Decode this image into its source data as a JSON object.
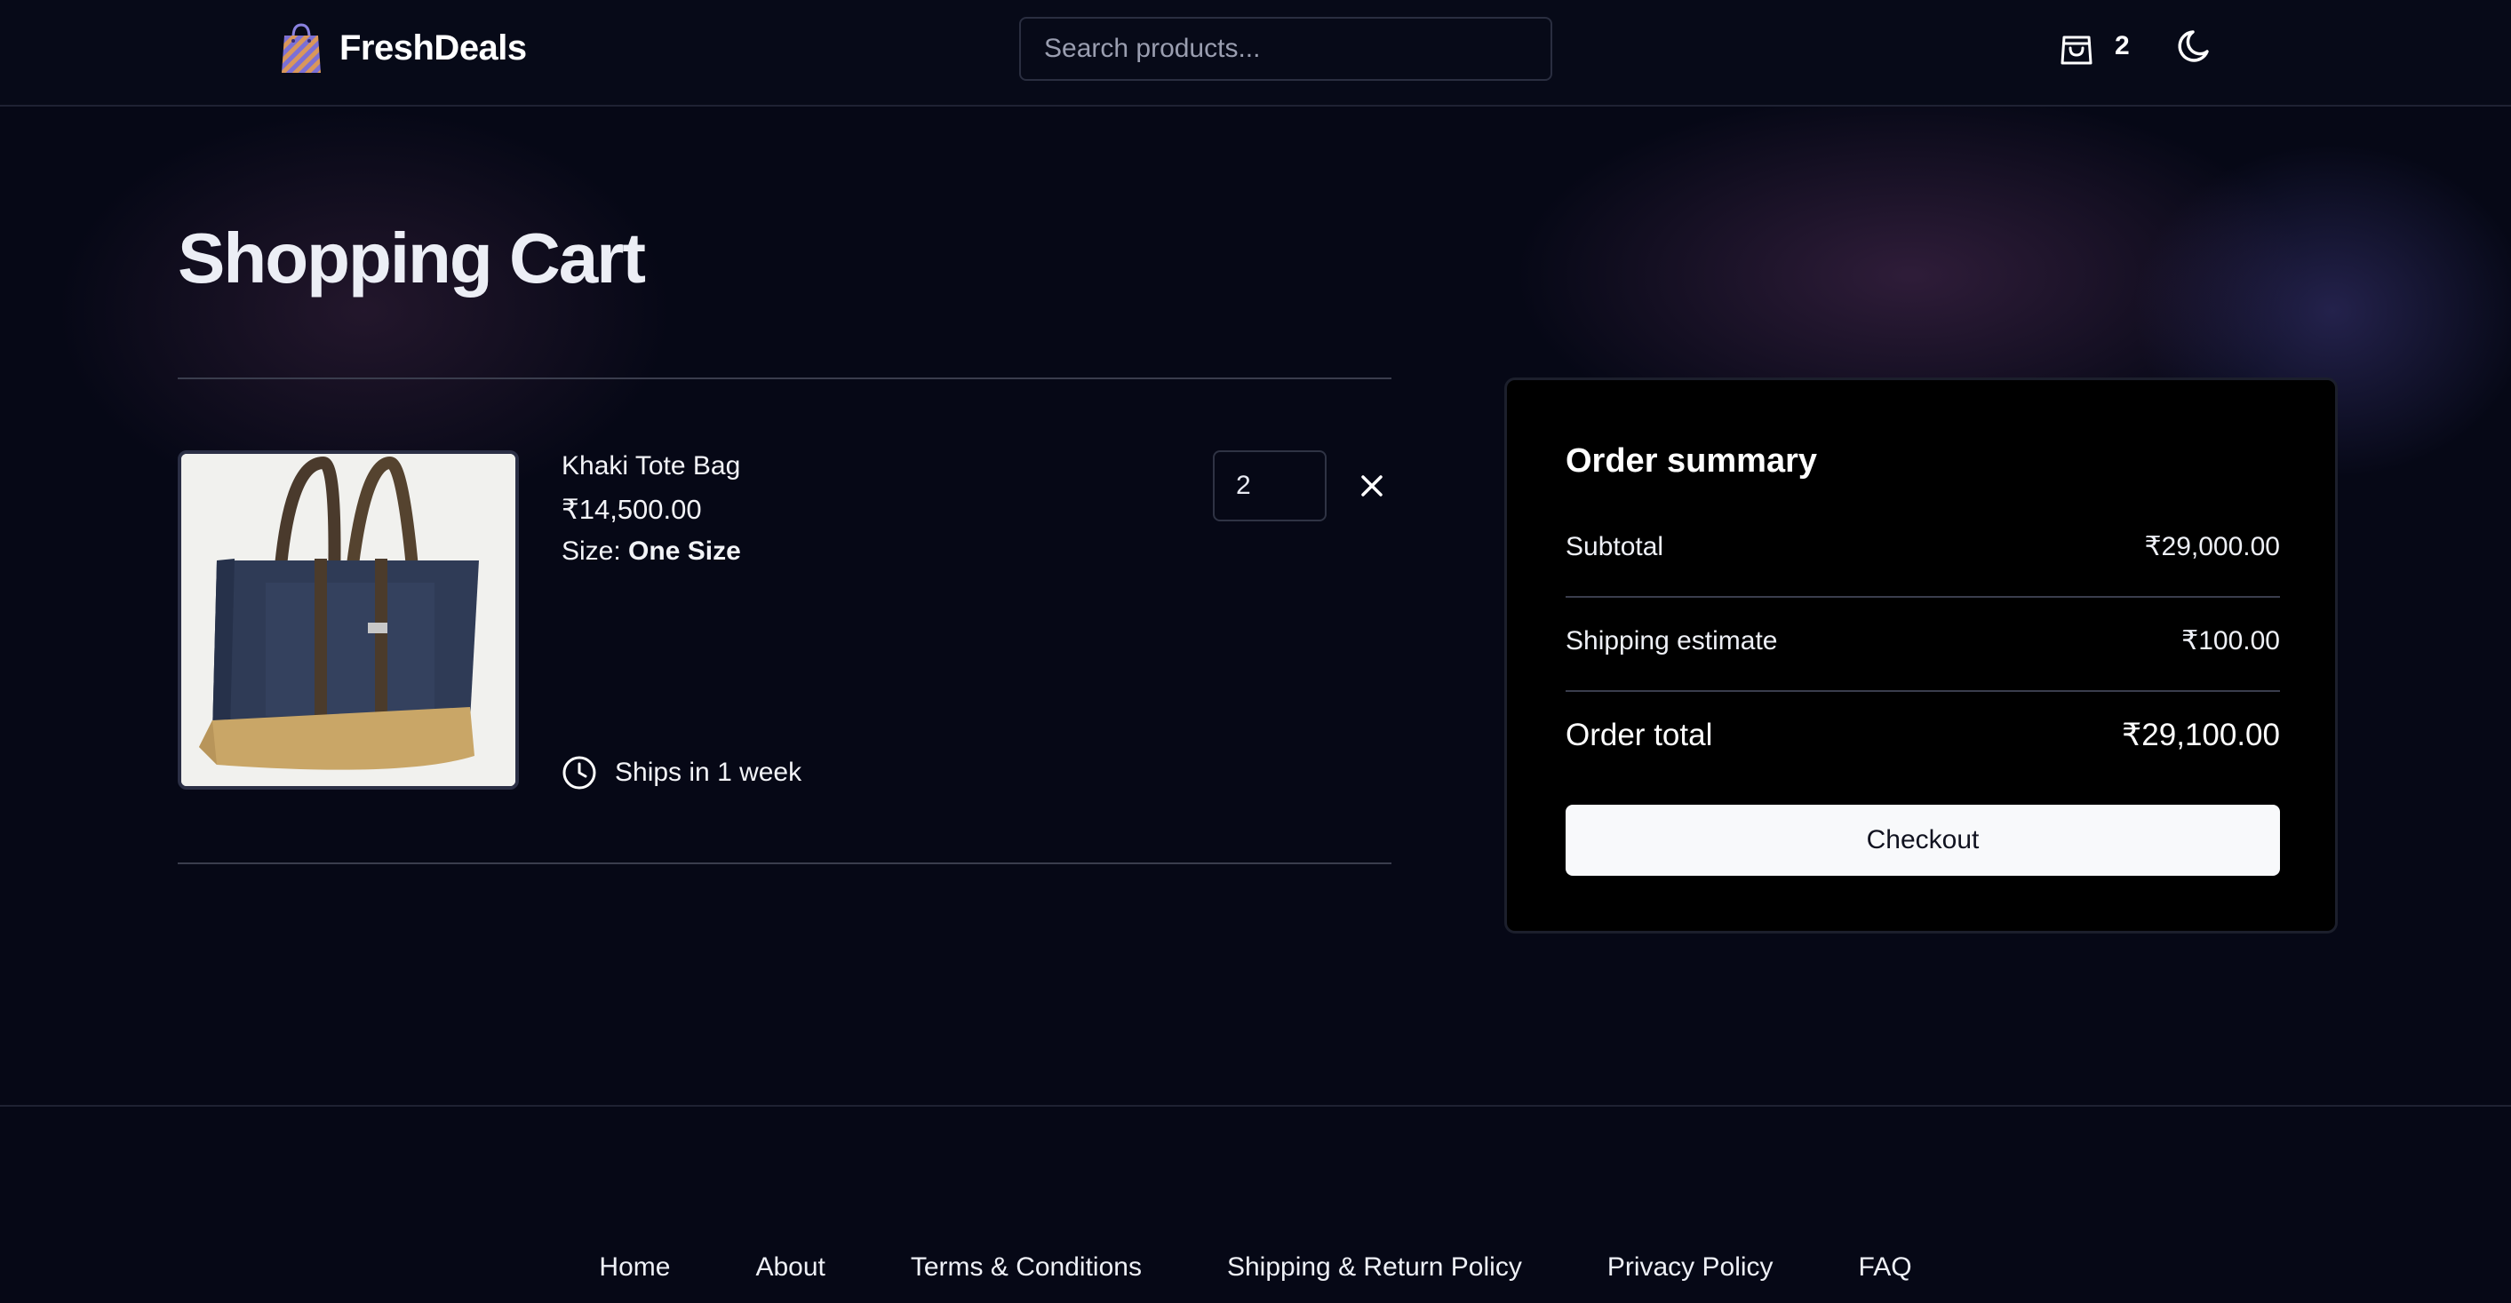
{
  "header": {
    "brand": "FreshDeals",
    "search_placeholder": "Search products...",
    "cart_count": "2",
    "icons": {
      "logo": "shopping-bag-icon",
      "cart": "cart-bag-icon",
      "theme": "moon-icon"
    }
  },
  "page": {
    "title": "Shopping Cart"
  },
  "cart": {
    "items": [
      {
        "name": "Khaki Tote Bag",
        "price": "₹14,500.00",
        "size_label": "Size:",
        "size_value": "One Size",
        "quantity": "2",
        "shipping_note": "Ships in 1 week",
        "image": "tote-bag-photo"
      }
    ]
  },
  "summary": {
    "title": "Order summary",
    "subtotal_label": "Subtotal",
    "subtotal_value": "₹29,000.00",
    "shipping_label": "Shipping estimate",
    "shipping_value": "₹100.00",
    "total_label": "Order total",
    "total_value": "₹29,100.00",
    "checkout_label": "Checkout"
  },
  "footer": {
    "links": [
      "Home",
      "About",
      "Terms & Conditions",
      "Shipping & Return Policy",
      "Privacy Policy",
      "FAQ"
    ]
  },
  "colors": {
    "background": "#060816",
    "surface": "#000000",
    "text": "#f2f3f7",
    "button": "#f8f9fb"
  }
}
